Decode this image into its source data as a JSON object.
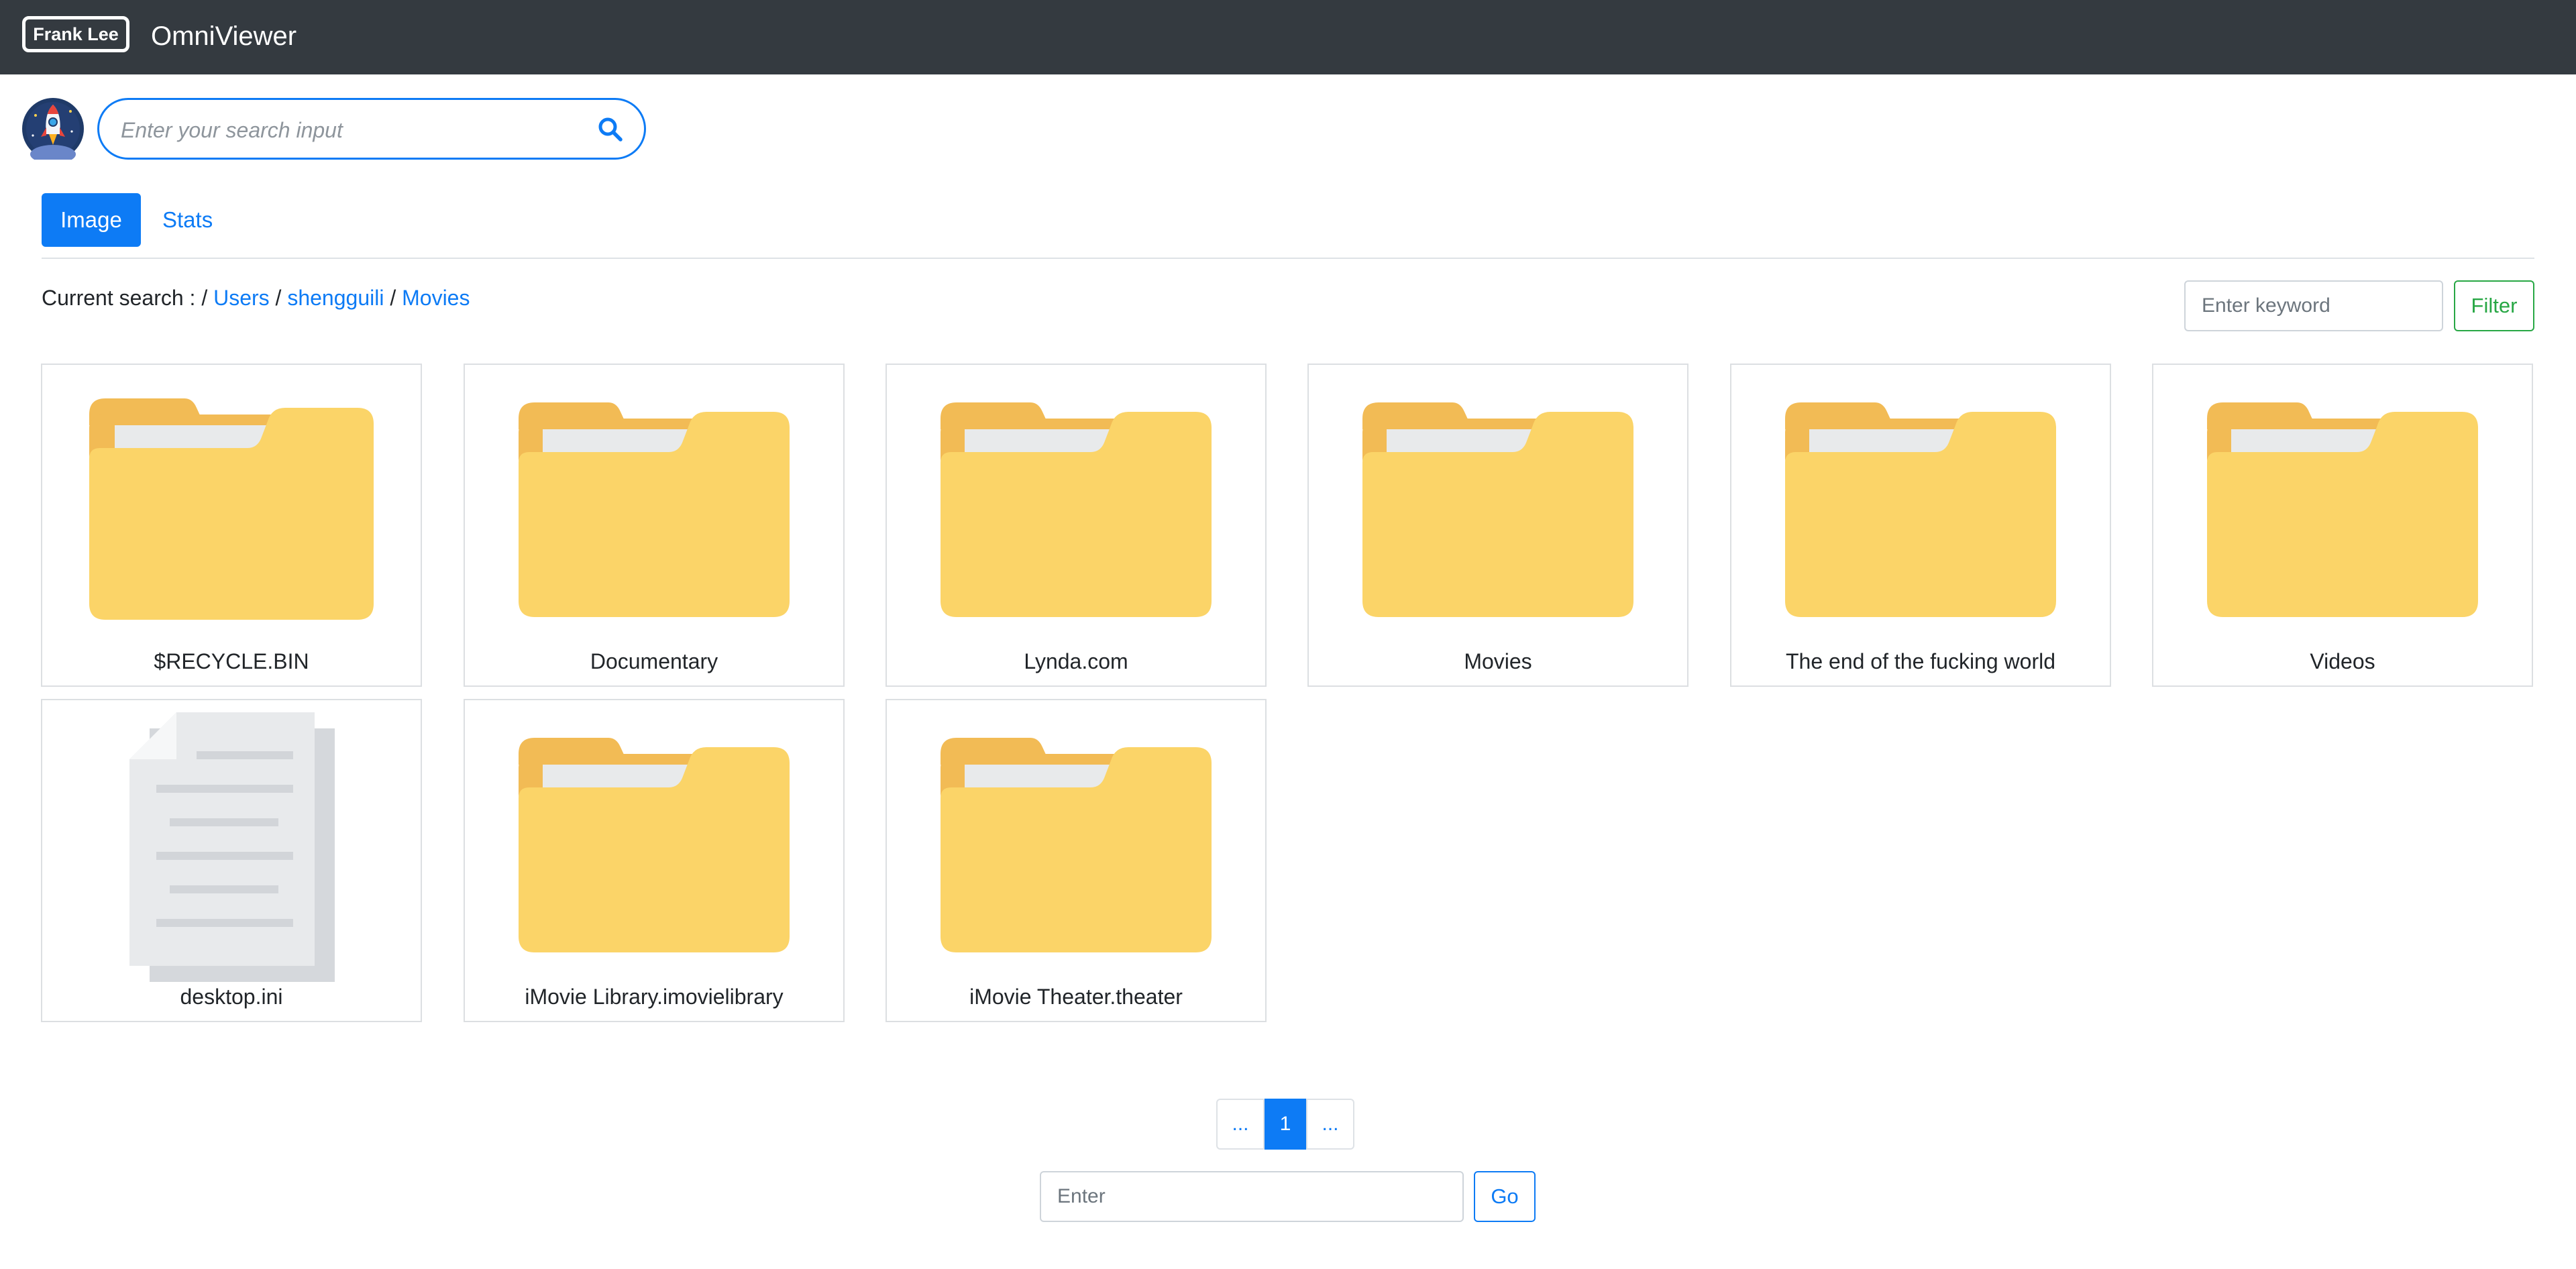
{
  "navbar": {
    "user_label": "Frank Lee",
    "brand": "OmniViewer",
    "background_color": "#343a40"
  },
  "search": {
    "placeholder": "Enter your search input",
    "value": "",
    "icon": "search-icon",
    "accent_color": "#0d7bf5"
  },
  "tabs": [
    {
      "label": "Image",
      "active": true
    },
    {
      "label": "Stats",
      "active": false
    }
  ],
  "breadcrumb": {
    "prefix": "Current search : /",
    "items": [
      "Users",
      "shengguili",
      "Movies"
    ],
    "separator": "/"
  },
  "filter": {
    "placeholder": "Enter keyword",
    "value": "",
    "button_label": "Filter",
    "button_color": "#28a745"
  },
  "items": [
    {
      "name": "$RECYCLE.BIN",
      "type": "folder",
      "icon": "folder-icon"
    },
    {
      "name": "Documentary",
      "type": "folder",
      "icon": "folder-icon"
    },
    {
      "name": "Lynda.com",
      "type": "folder",
      "icon": "folder-icon"
    },
    {
      "name": "Movies",
      "type": "folder",
      "icon": "folder-icon"
    },
    {
      "name": "The end of the fucking world",
      "type": "folder",
      "icon": "folder-icon"
    },
    {
      "name": "Videos",
      "type": "folder",
      "icon": "folder-icon"
    },
    {
      "name": "desktop.ini",
      "type": "file",
      "icon": "document-icon"
    },
    {
      "name": "iMovie Library.imovielibrary",
      "type": "folder",
      "icon": "folder-icon"
    },
    {
      "name": "iMovie Theater.theater",
      "type": "folder",
      "icon": "folder-icon"
    }
  ],
  "pagination": {
    "prev": "...",
    "current": "1",
    "next": "..."
  },
  "goto": {
    "placeholder": "Enter",
    "value": "",
    "button_label": "Go"
  }
}
